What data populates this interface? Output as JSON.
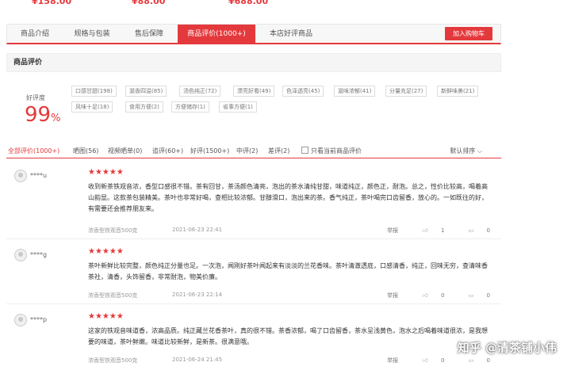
{
  "top_prices": [
    "¥158.00",
    "¥88.00",
    "¥688.00"
  ],
  "tabs": [
    {
      "label": "商品介绍"
    },
    {
      "label": "规格与包装"
    },
    {
      "label": "售后保障"
    },
    {
      "label": "商品评价(1000+)"
    },
    {
      "label": "本店好评商品"
    }
  ],
  "cart_button": "加入购物车",
  "section_title": "商品评价",
  "rating": {
    "label": "好评度",
    "value": "99",
    "unit": "%"
  },
  "tags": [
    "口感甘甜(198)",
    "滋香四溢(85)",
    "汤色纯正(72)",
    "漂亮好看(49)",
    "色泽透亮(45)",
    "滋味浓郁(41)",
    "分量充足(27)",
    "新鲜味美(21)",
    "风味十足(18)",
    "食用方便(2)",
    "方便储存(1)",
    "省事方便(1)"
  ],
  "filters": [
    "全部评价(1000+)",
    "晒图(56)",
    "视频晒单(0)",
    "追评(60+)",
    "好评(1500+)",
    "中评(2)",
    "差评(2)",
    "只看当前商品评价"
  ],
  "sort_label": "默认排序",
  "reviews": [
    {
      "user": "****u",
      "stars": "★★★★★",
      "content": "收到新茶铁观音浓，香型口感很不错。茶有回甘，茶汤颜色清亮，泡出的茶水清纯甘甜，味道纯正，颜色正，耐泡。总之，性价比较高，喝着高山韵显。这款茶包装精美。茶叶也非常好喝，查相比较浓郁。甘醇滑口，泡出来的茶。香气纯正，茶叶喝完口齿留香，放心的。一如既往的好，有需要还会推荐朋友来。",
      "spec": "浓香型铁观音500克",
      "date": "2021-06-23 22:41",
      "report": "举报",
      "likes": "1",
      "comments": "0"
    },
    {
      "user": "****g",
      "stars": "★★★★★",
      "content": "茶叶新鲜比较完整，颜色纯正分量也足。一次泡，闻刚好茶叶闻起来有淡淡的兰花香味。茶叶清澈透底，口感清香，纯正，回味无穷，查清味香茶社，清香，头饰留香，非常耐泡，物美价廉。",
      "spec": "浓香型铁观音500克",
      "date": "2021-06-23 22:14",
      "report": "举报",
      "likes": "0",
      "comments": "0"
    },
    {
      "user": "****p",
      "stars": "★★★★★",
      "content": "这家的铁观音味道香，浓高品质。纯正藏兰花香茶叶，真的很不错。茶香浓郁，喝了口齿留香，茶水呈浅黄色，泡水之后喝着味道很浓，是我想要的味道，茶叶鲜嫩。味道比较新鲜，是新茶。很满意哦。",
      "spec": "浓香型铁观音500克",
      "date": "2021-06-24 21:45",
      "report": "举报",
      "likes": "0",
      "comments": "0"
    }
  ],
  "watermark": "知乎 @清茶铺小伟"
}
